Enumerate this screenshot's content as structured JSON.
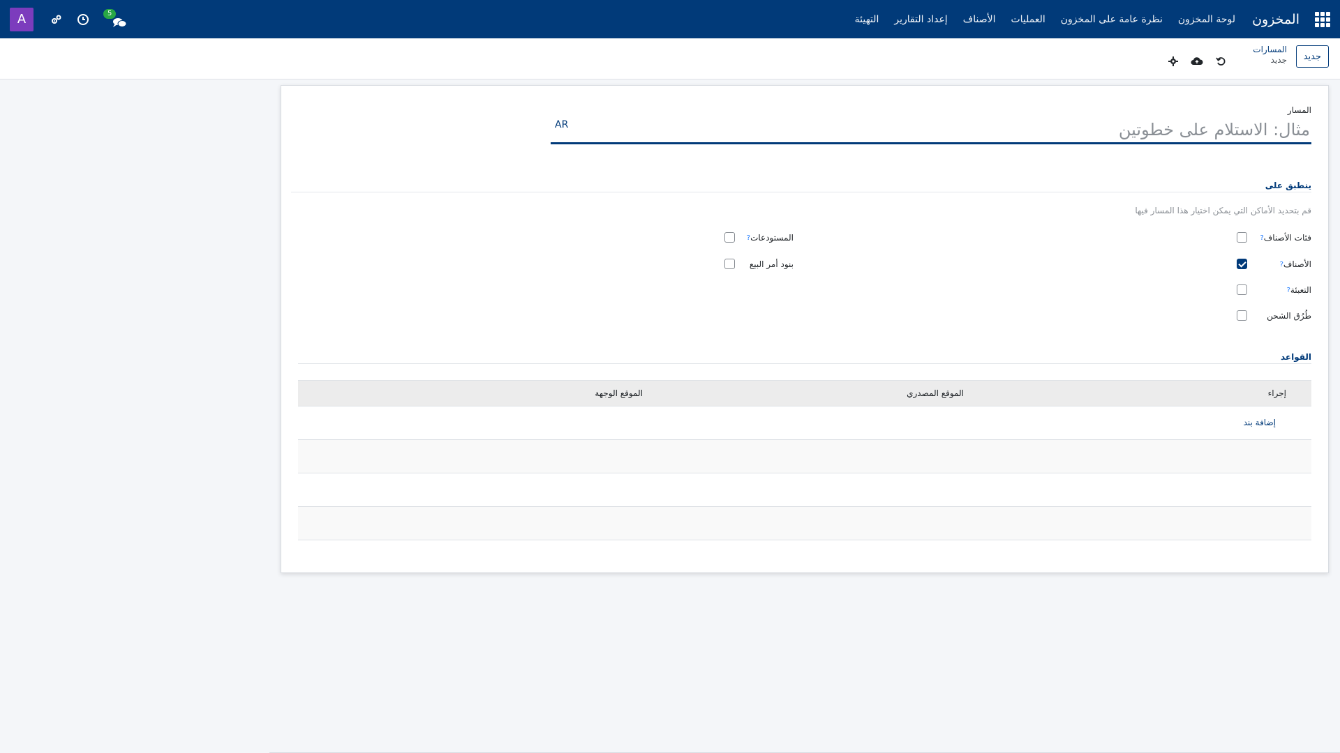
{
  "navbar": {
    "brand": "المخزون",
    "menu": [
      "لوحة المخزون",
      "نظرة عامة على المخزون",
      "العمليات",
      "الأصناف",
      "إعداد التقارير",
      "التهيئة"
    ],
    "chat_badge": "5",
    "avatar_letter": "A",
    "bg_color": "#013a79"
  },
  "control_panel": {
    "new_button": "جديد",
    "breadcrumb_parent": "المسارات",
    "breadcrumb_current": "جديد"
  },
  "form": {
    "route_label": "المسار",
    "route_placeholder": "مثال: الاستلام على خطوتين",
    "lang_button": "AR",
    "applies_on_title": "ينطبق على",
    "applies_on_hint": "قم بتحديد الأماكن التي يمكن اختيار هذا المسار فيها",
    "checkboxes_right": [
      {
        "label": "فئات الأصناف",
        "help": "?",
        "checked": false
      },
      {
        "label": "الأصناف",
        "help": "?",
        "checked": true
      },
      {
        "label": "التعبئة",
        "help": "?",
        "checked": false
      },
      {
        "label": "طُرُق الشحن",
        "help": "",
        "checked": false
      }
    ],
    "checkboxes_left": [
      {
        "label": "المستودعات",
        "help": "?",
        "checked": false
      },
      {
        "label": "بنود أمر البيع",
        "help": "",
        "checked": false
      }
    ],
    "rules_title": "القواعد",
    "rules_table": {
      "columns": [
        "إجراء",
        "الموقع المصدري",
        "الموقع الوجهة"
      ],
      "add_line": "إضافة بند"
    }
  }
}
